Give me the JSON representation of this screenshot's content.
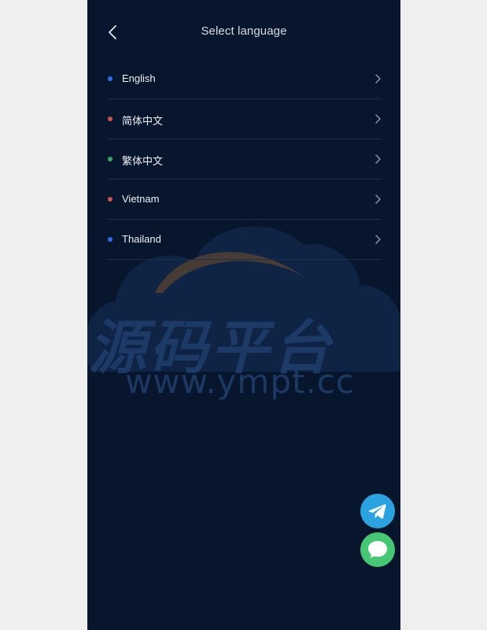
{
  "header": {
    "title": "Select language",
    "back_icon": "chevron-left-icon"
  },
  "languages": [
    {
      "label": "English",
      "dot_color": "#2f6df0"
    },
    {
      "label": "简体中文",
      "dot_color": "#c8534f"
    },
    {
      "label": "繁体中文",
      "dot_color": "#3aa86a"
    },
    {
      "label": "Vietnam",
      "dot_color": "#c8534f"
    },
    {
      "label": "Thailand",
      "dot_color": "#2f6df0"
    }
  ],
  "watermark": {
    "text": "源码平台",
    "url": "www.ympt.cc"
  },
  "floating_buttons": {
    "telegram_icon": "telegram-icon",
    "chat_icon": "chat-bubble-icon",
    "telegram_color": "#2aa3e0",
    "chat_color": "#45c774"
  },
  "colors": {
    "background": "#08162d",
    "divider": "#1e2e47"
  }
}
